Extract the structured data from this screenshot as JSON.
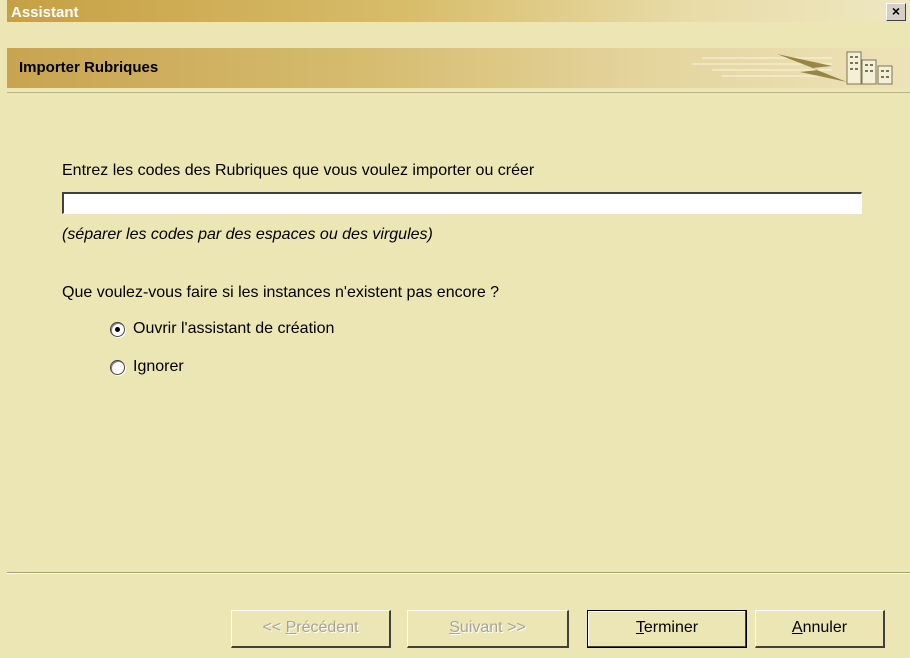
{
  "window": {
    "title": "Assistant",
    "close_glyph": "×"
  },
  "header": {
    "subtitle": "Importer Rubriques",
    "banner_icon": "building-lightning-icon"
  },
  "form": {
    "prompt": "Entrez les codes des  Rubriques  que vous voulez importer ou créer",
    "codes_value": "",
    "hint": "(séparer les codes par des espaces ou des virgules)",
    "question": "Que voulez-vous faire si les instances n'existent pas encore ?",
    "options": [
      {
        "label": "Ouvrir l'assistant de création",
        "selected": true
      },
      {
        "label": "Ignorer",
        "selected": false
      }
    ]
  },
  "buttons": {
    "prev": {
      "prefix": "<< ",
      "mnemonic": "P",
      "rest": "récédent",
      "enabled": false
    },
    "next": {
      "prefix": "",
      "mnemonic": "S",
      "rest": "uivant >>",
      "enabled": false
    },
    "finish": {
      "mnemonic": "T",
      "rest": "erminer",
      "enabled": true
    },
    "cancel": {
      "mnemonic": "A",
      "rest": "nnuler",
      "enabled": true
    }
  }
}
